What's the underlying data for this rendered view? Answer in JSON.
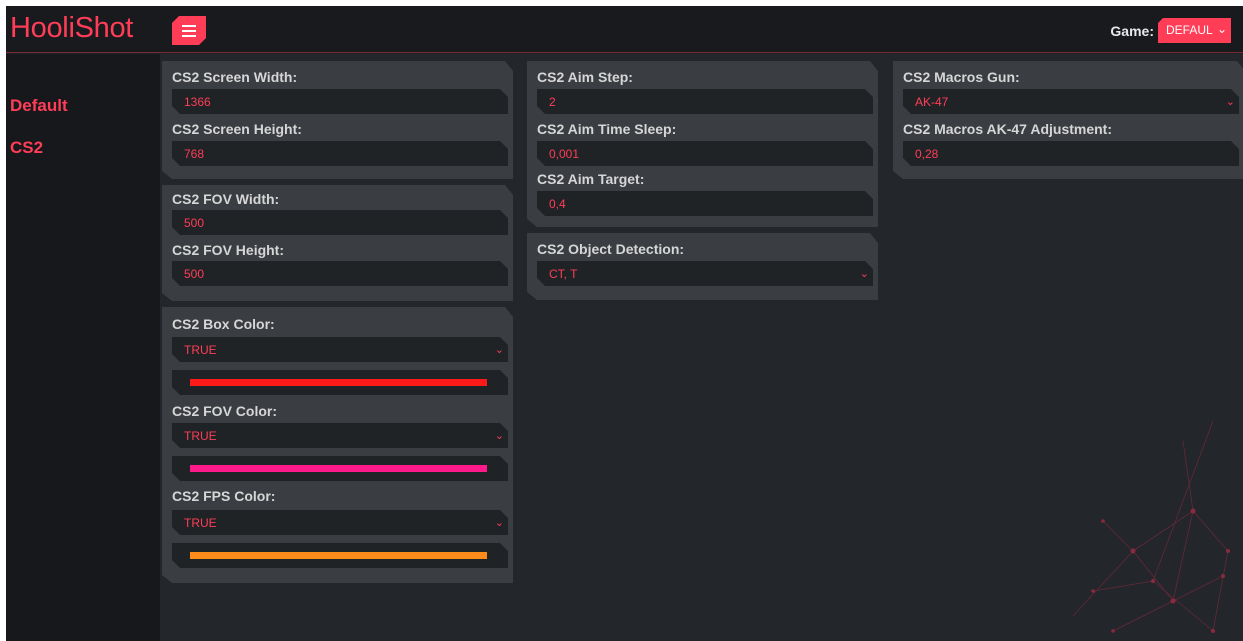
{
  "app": {
    "title": "HooliShot"
  },
  "header": {
    "game_label": "Game:",
    "game_value": "DEFAUL"
  },
  "sidebar": {
    "items": [
      {
        "label": "Default"
      },
      {
        "label": "CS2"
      }
    ]
  },
  "settings": {
    "screen_width": {
      "label": "CS2 Screen Width:",
      "value": "1366"
    },
    "screen_height": {
      "label": "CS2 Screen Height:",
      "value": "768"
    },
    "fov_width": {
      "label": "CS2 FOV Width:",
      "value": "500"
    },
    "fov_height": {
      "label": "CS2 FOV Height:",
      "value": "500"
    },
    "box_color": {
      "label": "CS2 Box Color:",
      "value": "TRUE",
      "color": "#ff1a1a"
    },
    "fov_color": {
      "label": "CS2 FOV Color:",
      "value": "TRUE",
      "color": "#ff1a8c"
    },
    "fps_color": {
      "label": "CS2 FPS Color:",
      "value": "TRUE",
      "color": "#ff8c1a"
    },
    "aim_step": {
      "label": "CS2 Aim Step:",
      "value": "2"
    },
    "aim_time_sleep": {
      "label": "CS2 Aim Time Sleep:",
      "value": "0,001"
    },
    "aim_target": {
      "label": "CS2 Aim Target:",
      "value": "0,4"
    },
    "object_detection": {
      "label": "CS2 Object Detection:",
      "value": "CT, T"
    },
    "macros_gun": {
      "label": "CS2 Macros Gun:",
      "value": "AK-47"
    },
    "macros_adjustment": {
      "label": "CS2 Macros AK-47 Adjustment:",
      "value": "0,28"
    }
  },
  "theme": {
    "accent": "#ff3d57"
  }
}
